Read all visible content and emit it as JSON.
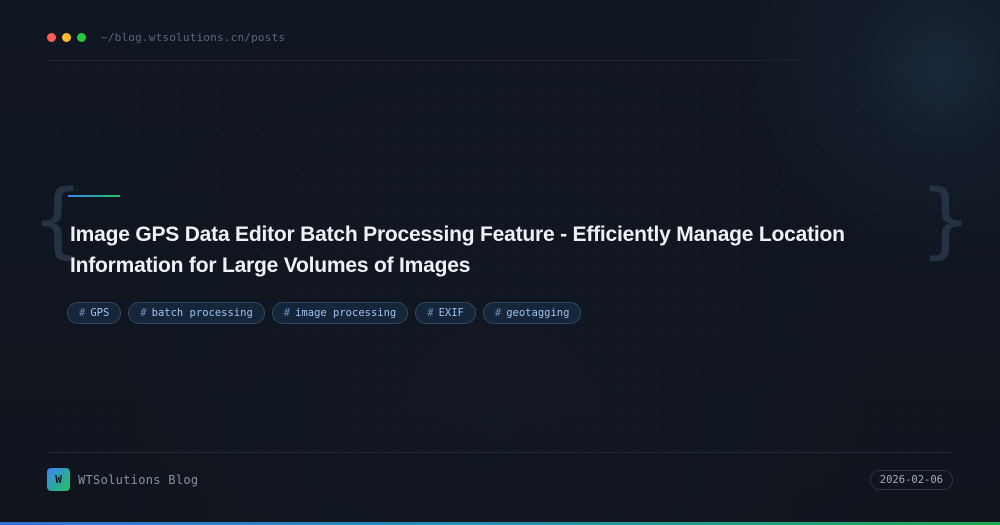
{
  "header": {
    "window_dots": [
      {
        "name": "close",
        "color": "#ff5f57"
      },
      {
        "name": "minimize",
        "color": "#febc2e"
      },
      {
        "name": "maximize",
        "color": "#28c840"
      }
    ],
    "path": "~/blog.wtsolutions.cn/posts"
  },
  "post": {
    "title_line1": "Image GPS Data Editor Batch Processing Feature - Efficiently Manage Location",
    "title_line2": "Information for Large Volumes of Images",
    "tags": [
      {
        "hash": "#",
        "label": "GPS"
      },
      {
        "hash": "#",
        "label": "batch processing"
      },
      {
        "hash": "#",
        "label": "image processing"
      },
      {
        "hash": "#",
        "label": "EXIF"
      },
      {
        "hash": "#",
        "label": "geotagging"
      }
    ],
    "brace_left": "{",
    "brace_right": "}"
  },
  "footer": {
    "logo_letter": "W",
    "brand_name": "WTSolutions Blog",
    "date": "2026-02-06"
  },
  "colors": {
    "accent_blue": "#3b82f6",
    "accent_green": "#22c55e",
    "background": "#10151f"
  }
}
